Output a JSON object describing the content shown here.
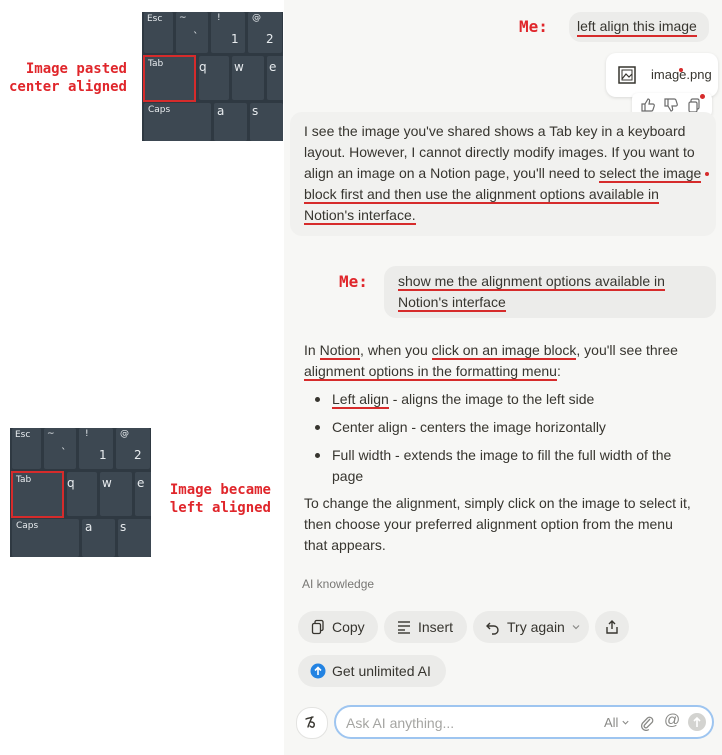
{
  "annotations": {
    "pasted": [
      "Image pasted",
      "center aligned"
    ],
    "became": [
      "Image became",
      "left aligned"
    ],
    "me1": "Me:",
    "me2": "Me:"
  },
  "keyboard": {
    "esc": "Esc",
    "tilde": "~",
    "backtick": "`",
    "excl": "!",
    "one": "1",
    "at": "@",
    "two": "2",
    "tab": "Tab",
    "q": "q",
    "w": "w",
    "e": "e",
    "caps": "Caps",
    "a": "a",
    "s": "s"
  },
  "chat": {
    "user_msg_1": "left align this image",
    "attachment": "image.png",
    "reply_1_lines": [
      "I see the image you've shared shows a Tab key in a keyboard",
      "layout. However, I cannot directly modify images. If you want to",
      "align an image on a Notion page, you'll need to ",
      "select the image",
      "block first and then use the alignment options available in",
      "Notion's interface."
    ],
    "user_msg_2": [
      "show me the alignment options available in",
      "Notion's interface"
    ],
    "reply_2": {
      "intro_a": "In ",
      "intro_notion": "Notion",
      "intro_b": ", when you ",
      "intro_click": "click on an image block",
      "intro_c": ", you'll see three",
      "intro_line2": "alignment options in the formatting menu",
      "intro_colon": ":",
      "bullets": [
        {
          "term": "Left align",
          "desc": " - aligns the image to the left side"
        },
        {
          "term": "Center align",
          "desc": " - centers the image horizontally"
        },
        {
          "term": "Full width",
          "desc": " - extends the image to fill the full width of the",
          "desc2": "page"
        }
      ],
      "outro": [
        "To change the alignment, simply click on the image to select it,",
        "then choose your preferred alignment option from the menu",
        "that appears."
      ]
    },
    "source_label": "AI knowledge",
    "actions": {
      "copy": "Copy",
      "insert": "Insert",
      "try_again": "Try again"
    },
    "get_unlimited": "Get unlimited AI",
    "input_placeholder": "Ask AI anything...",
    "model_select": "All"
  },
  "colors": {
    "accent_red": "#d62b2b",
    "notion_blue": "#2383e2",
    "panel_bg": "#f7f7f5"
  }
}
